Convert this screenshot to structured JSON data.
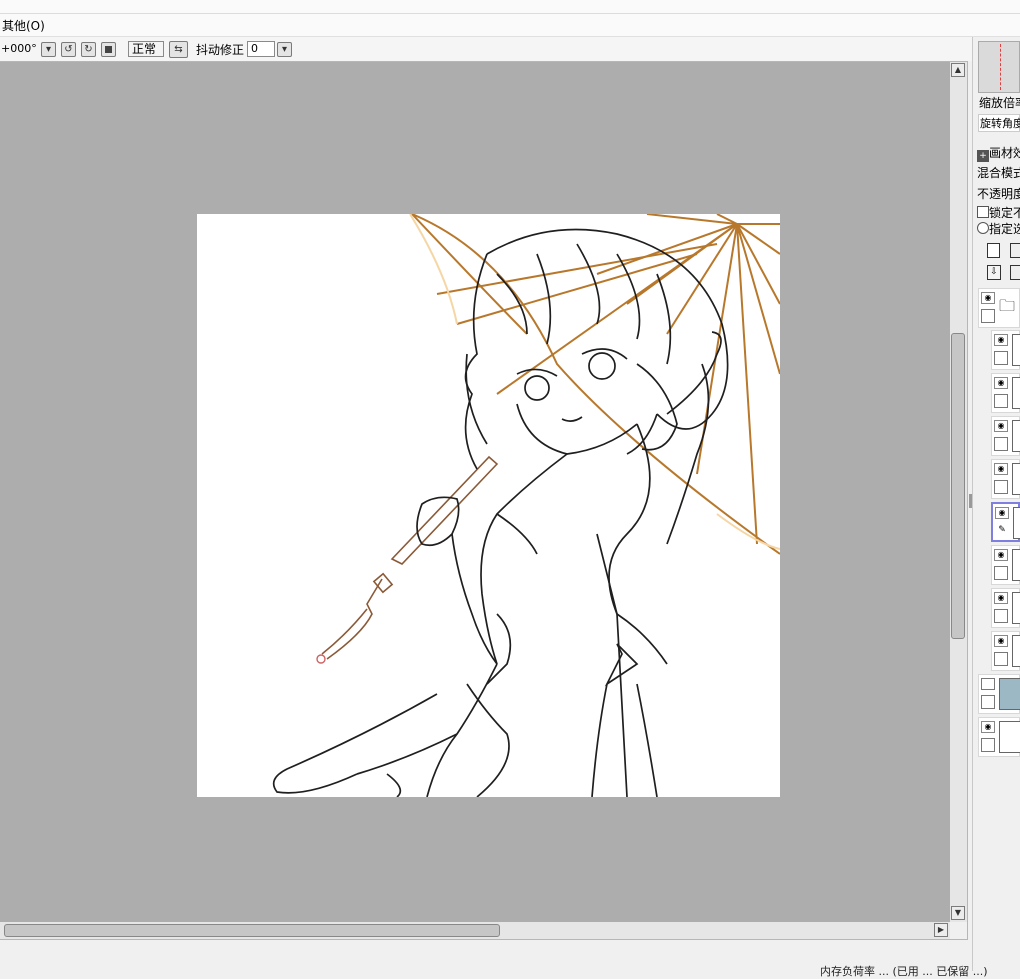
{
  "menu": {
    "other": "其他(O)"
  },
  "toolbar": {
    "rotation_value": "+000°",
    "blend_mode": "正常",
    "stabilizer_label": "抖动修正",
    "stabilizer_value": "0"
  },
  "panel": {
    "zoom_label": "缩放倍率",
    "rotate_label": "旋转角度",
    "paper_texture": "画材效果",
    "blend_mode_label": "混合模式",
    "opacity_label": "不透明度",
    "lock_label": "锁定不透明度",
    "select_label": "指定选区"
  },
  "status": {
    "text": "内存负荷率 ... (已用 ... 已保留 ...)"
  },
  "colors": {
    "accent": "#e8a878",
    "canvas_bg": "#adadad",
    "active_layer": "#7f7fe0"
  }
}
